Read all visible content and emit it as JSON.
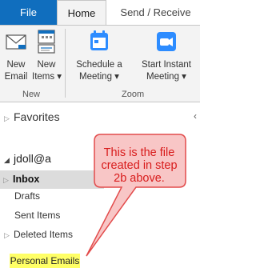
{
  "tabs": {
    "file": "File",
    "home": "Home",
    "send_receive": "Send / Receive"
  },
  "ribbon": {
    "new_email": [
      "New",
      "Email"
    ],
    "new_items": [
      "New",
      "Items ▾"
    ],
    "schedule_meeting": [
      "Schedule a",
      "Meeting ▾"
    ],
    "start_instant_meeting": [
      "Start Instant",
      "Meeting ▾"
    ],
    "group_new": "New",
    "group_zoom": "Zoom"
  },
  "nav": {
    "favorites": "Favorites",
    "account": "jdoll@a",
    "folders": {
      "inbox": "Inbox",
      "drafts": "Drafts",
      "sent": "Sent Items",
      "deleted": "Deleted Items",
      "personal": "Personal Emails"
    }
  },
  "callout": {
    "lines": [
      "This is the file",
      "created in step",
      "2b above."
    ]
  },
  "colors": {
    "file_tab": "#106ebe",
    "ribbon_bg": "#f3f3f3",
    "zoom_icon": "#2d8cff",
    "callout_fill": "#f8c6c6",
    "callout_stroke": "#e24b4b",
    "callout_text": "#d81b1b",
    "highlight": "#ffff66",
    "selected_row": "#dcdcdc"
  }
}
